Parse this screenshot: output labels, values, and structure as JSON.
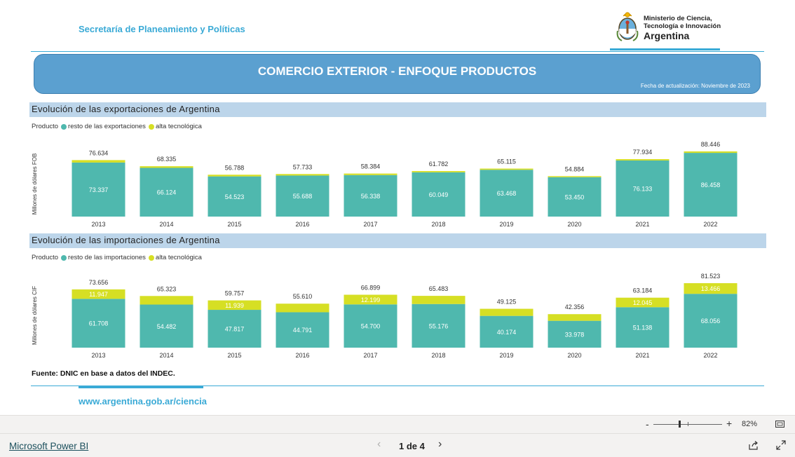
{
  "header": {
    "secretaria": "Secretaría de Planeamiento y Políticas",
    "logo": {
      "line1": "Ministerio de Ciencia,",
      "line2": "Tecnología e Innovación",
      "line3": "Argentina"
    }
  },
  "banner": {
    "title": "COMERCIO EXTERIOR - ENFOQUE PRODUCTOS",
    "fecha": "Fecha de actualización: Noviembre de 2023"
  },
  "colors": {
    "resto": "#4fb8ae",
    "alta": "#d6df24",
    "accent": "#3aaad6",
    "banner": "#5ba0d0",
    "section": "#bcd5ea"
  },
  "chart_data": [
    {
      "type": "bar",
      "stacked": true,
      "title": "Evolución de las exportaciones de Argentina",
      "legend_title": "Producto",
      "ylabel": "Millones de dólares FOB",
      "ylim": [
        0,
        88446
      ],
      "grid": false,
      "legend_position": "top-left",
      "categories": [
        "2013",
        "2014",
        "2015",
        "2016",
        "2017",
        "2018",
        "2019",
        "2020",
        "2021",
        "2022"
      ],
      "series": [
        {
          "name": "resto de las exportaciones",
          "values": [
            73337,
            66124,
            54523,
            55688,
            56338,
            60049,
            63468,
            53450,
            76133,
            86458
          ],
          "labels": [
            "73.337",
            "66.124",
            "54.523",
            "55.688",
            "56.338",
            "60.049",
            "63.468",
            "53.450",
            "76.133",
            "86.458"
          ]
        },
        {
          "name": "alta tecnológica",
          "values": [
            3297,
            2211,
            2265,
            2045,
            2046,
            1733,
            1647,
            1434,
            1801,
            1988
          ],
          "labels": [
            "",
            "",
            "",
            "",
            "",
            "",
            "",
            "",
            "",
            ""
          ]
        }
      ],
      "totals": [
        "76.634",
        "68.335",
        "56.788",
        "57.733",
        "58.384",
        "61.782",
        "65.115",
        "54.884",
        "77.934",
        "88.446"
      ]
    },
    {
      "type": "bar",
      "stacked": true,
      "title": "Evolución de las importaciones de Argentina",
      "legend_title": "Producto",
      "ylabel": "Millones de dólares CIF",
      "ylim": [
        0,
        81523
      ],
      "grid": false,
      "legend_position": "top-left",
      "categories": [
        "2013",
        "2014",
        "2015",
        "2016",
        "2017",
        "2018",
        "2019",
        "2020",
        "2021",
        "2022"
      ],
      "series": [
        {
          "name": "resto de las importaciones",
          "values": [
            61708,
            54482,
            47817,
            44791,
            54700,
            55176,
            40174,
            33978,
            51138,
            68056
          ],
          "labels": [
            "61.708",
            "54.482",
            "47.817",
            "44.791",
            "54.700",
            "55.176",
            "40.174",
            "33.978",
            "51.138",
            "68.056"
          ]
        },
        {
          "name": "alta tecnológica",
          "values": [
            11947,
            10841,
            11939,
            10819,
            12199,
            10307,
            8951,
            8378,
            12045,
            13466
          ],
          "labels": [
            "11.947",
            "",
            "11.939",
            "",
            "12.199",
            "",
            "",
            "",
            "12.045",
            "13.466"
          ]
        }
      ],
      "totals": [
        "73.656",
        "65.323",
        "59.757",
        "55.610",
        "66.899",
        "65.483",
        "49.125",
        "42.356",
        "63.184",
        "81.523"
      ]
    }
  ],
  "fuente": "Fuente: DNIC en base a datos del INDEC.",
  "site": "www.argentina.gob.ar/ciencia",
  "powerbi": {
    "brand": "Microsoft Power BI",
    "page_info": "1 de 4",
    "zoom_minus": "-",
    "zoom_plus": "+",
    "zoom_level": "82%",
    "prev_icon": "chevron-left-icon",
    "next_icon": "chevron-right-icon",
    "fit_icon": "fit-to-page-icon",
    "share_icon": "share-icon",
    "expand_icon": "expand-icon"
  }
}
